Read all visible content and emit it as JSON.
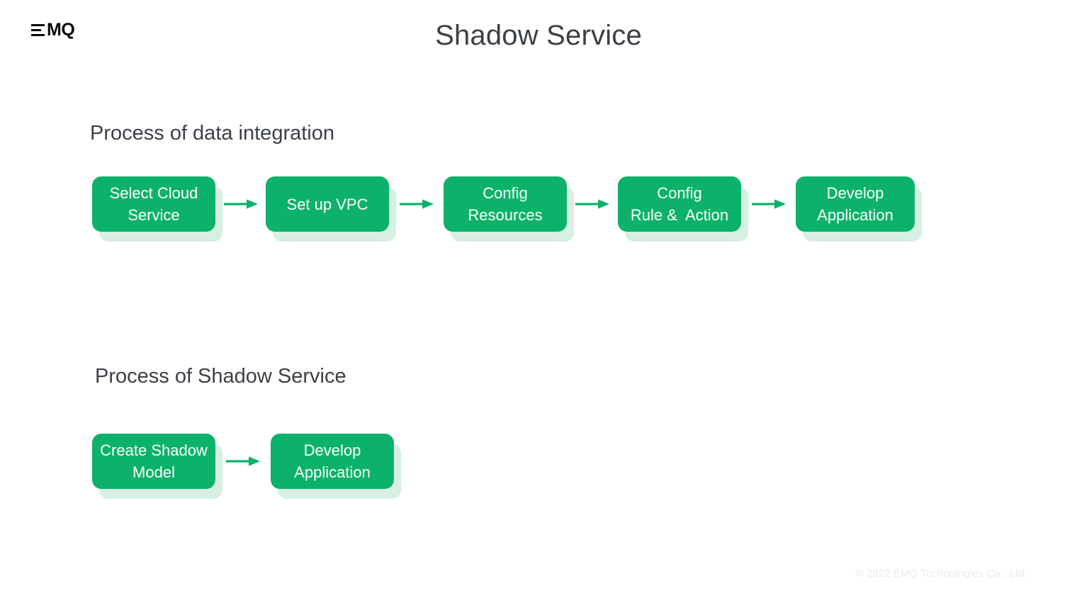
{
  "brand": {
    "logo_text": "MQ",
    "logo_icon": "emq-bars-logo"
  },
  "slide": {
    "title": "Shadow Service",
    "footer": "© 2022 EMQ Technologies Co., Ltd."
  },
  "colors": {
    "node_green": "#0cb26a",
    "node_shadow_green": "#d8efe3",
    "arrow_green": "#0cb26a",
    "title_text": "#3b3f47",
    "footer_text": "#e9eaec",
    "background": "#ffffff"
  },
  "sections": [
    {
      "heading": "Process of data integration",
      "nodes": [
        {
          "label": "Select Cloud\nService"
        },
        {
          "label": "Set up VPC"
        },
        {
          "label": "Config\nResources"
        },
        {
          "label": "Config\nRule &  Action"
        },
        {
          "label": "Develop\nApplication"
        }
      ]
    },
    {
      "heading": "Process of Shadow Service",
      "nodes": [
        {
          "label": "Create Shadow\nModel"
        },
        {
          "label": "Develop\nApplication"
        }
      ]
    }
  ]
}
